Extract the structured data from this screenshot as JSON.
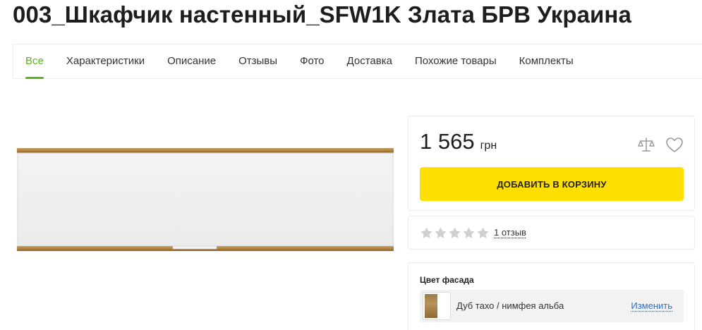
{
  "product": {
    "title": "003_Шкафчик настенный_SFW1K Злата БРВ Украина"
  },
  "tabs": [
    {
      "label": "Все",
      "active": true
    },
    {
      "label": "Характеристики"
    },
    {
      "label": "Описание"
    },
    {
      "label": "Отзывы"
    },
    {
      "label": "Фото"
    },
    {
      "label": "Доставка"
    },
    {
      "label": "Похожие товары"
    },
    {
      "label": "Комплекты"
    }
  ],
  "price": {
    "value": "1 565",
    "currency": "грн",
    "cart_button_label": "ДОБАВИТЬ В КОРЗИНУ"
  },
  "rating": {
    "stars": 0,
    "max_stars": 5,
    "reviews_label": "1 отзыв"
  },
  "facade": {
    "label": "Цвет фасада",
    "selected": "Дуб тахо / нимфея альба",
    "change_label": "Изменить"
  },
  "colors": {
    "accent": "#5bb21a",
    "cart_button": "#ffdf00",
    "link": "#2a6fc9"
  },
  "icons": [
    "compare-scales-icon",
    "heart-icon",
    "star-icon"
  ]
}
